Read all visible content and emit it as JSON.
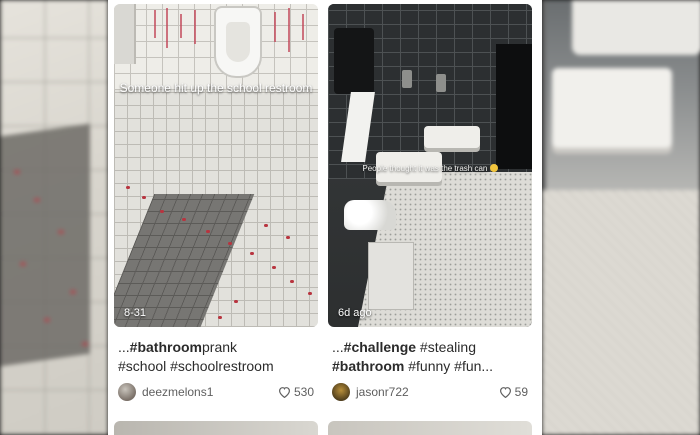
{
  "feed": {
    "videos": [
      {
        "overlay_text": "Someone hit up the school restroom",
        "date": "8-31",
        "title_line1_prefix": "...",
        "title_line1_bold": "#bathroom",
        "title_line1_rest": "prank",
        "title_line2": "#school #schoolrestroom",
        "author": "deezmelons1",
        "likes": "530"
      },
      {
        "overlay_text": "People thought it was the trash can",
        "date": "6d ago",
        "title_line1_prefix": "...",
        "title_line1_bold": "#challenge",
        "title_line1_rest": " #stealing",
        "title_line2_bold": "#bathroom",
        "title_line2_rest": " #funny #fun...",
        "author": "jasonr722",
        "likes": "59"
      }
    ]
  },
  "icons": {
    "like": "heart-outline-icon",
    "avatar": "user-avatar"
  },
  "colors": {
    "panel_bg": "#ffffff",
    "text_primary": "#2b2b2b",
    "text_secondary": "#5f5f5f"
  }
}
